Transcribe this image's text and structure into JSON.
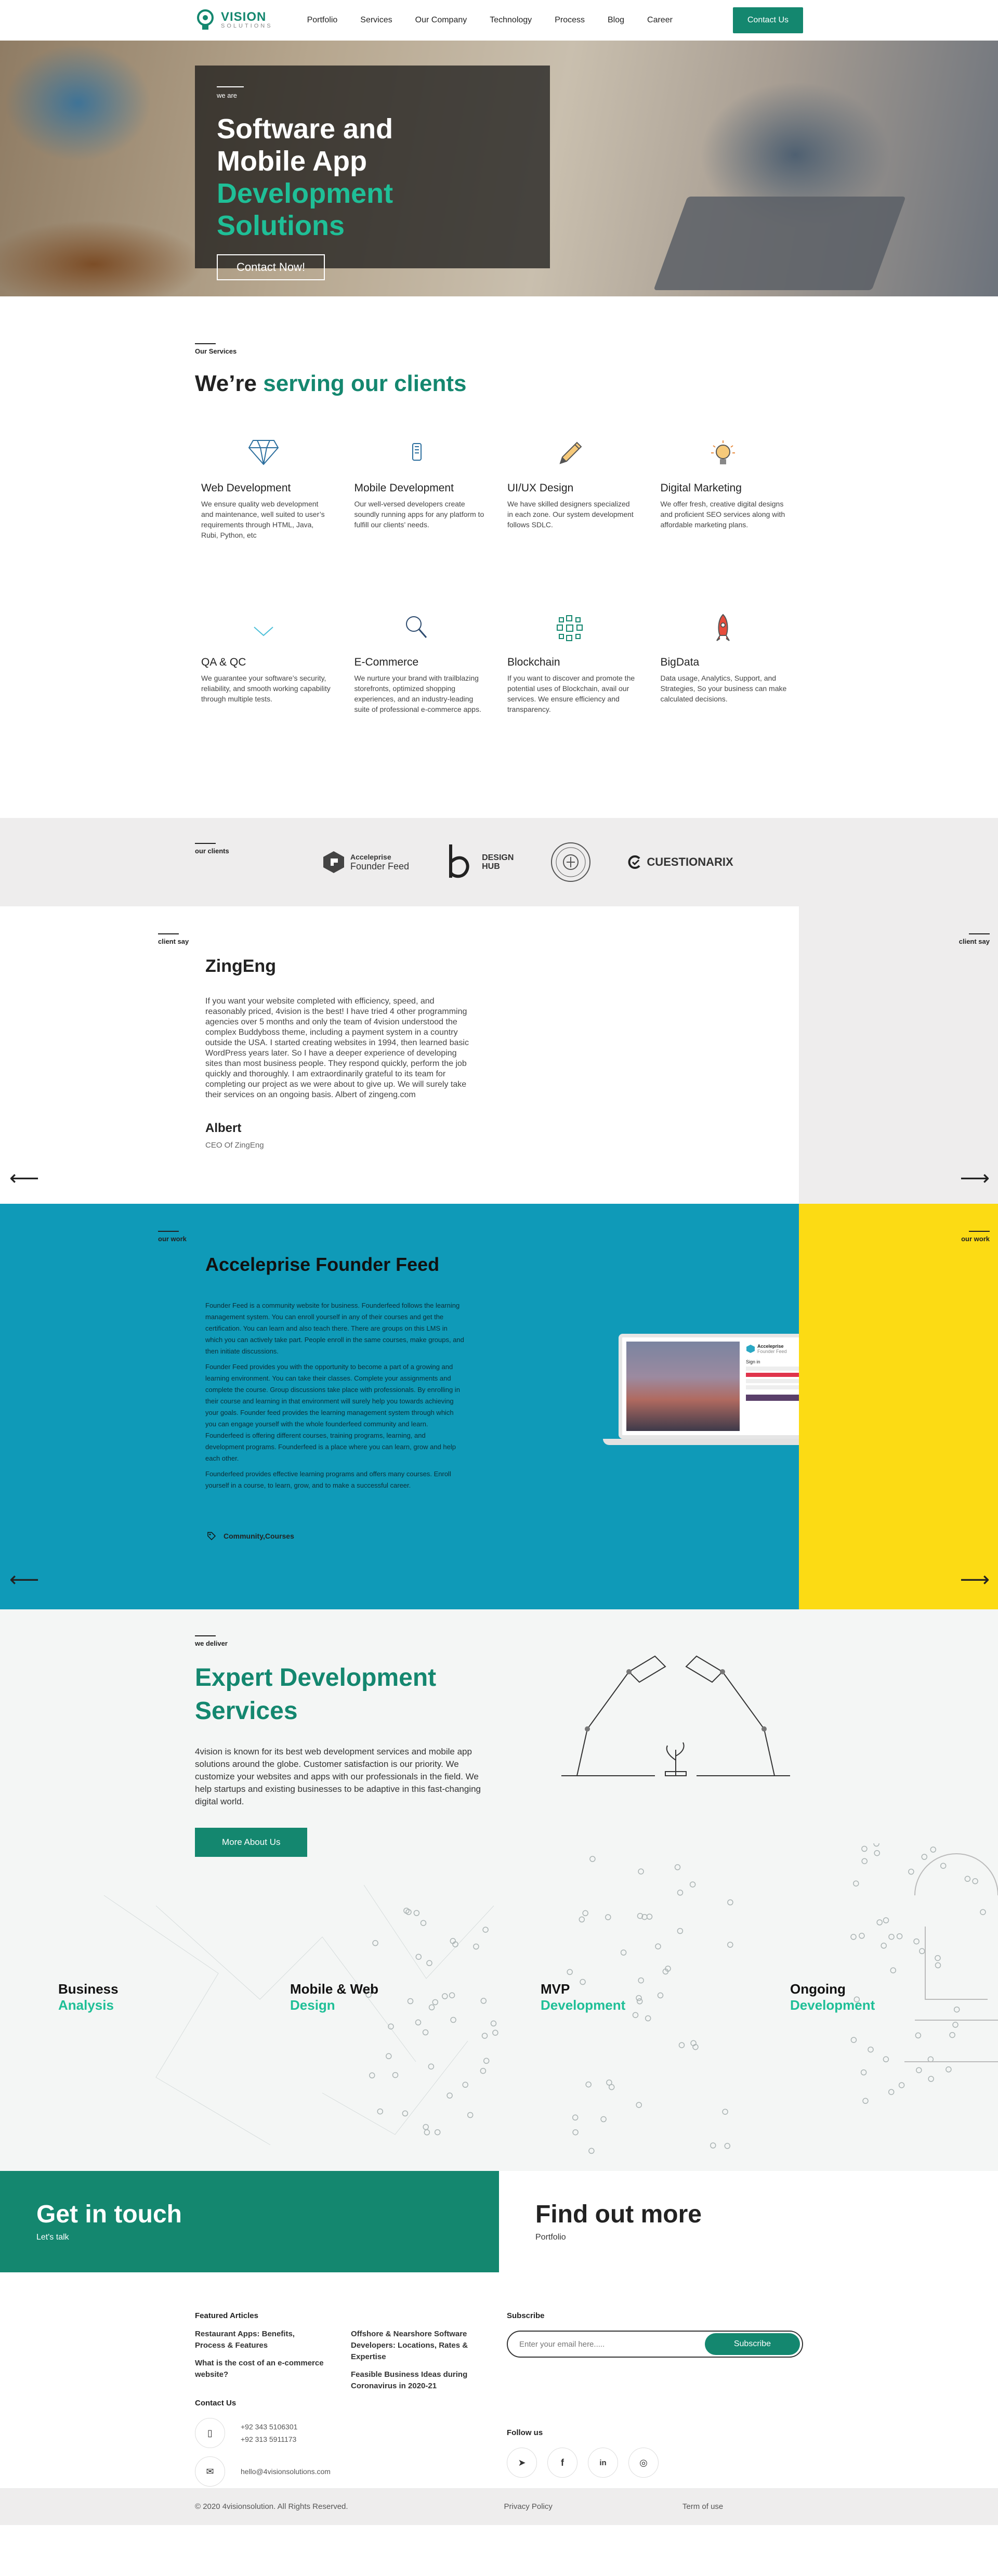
{
  "brand": {
    "name": "VISION",
    "tagline": "SOLUTIONS",
    "accent": "#14876f",
    "accent_light": "#1fbf97"
  },
  "nav": {
    "items": [
      "Portfolio",
      "Services",
      "Our Company",
      "Technology",
      "Process",
      "Blog",
      "Career"
    ],
    "cta": "Contact Us"
  },
  "hero": {
    "kicker": "we are",
    "line1": "Software and",
    "line2": "Mobile App",
    "line3": "Development Solutions",
    "button": "Contact Now!"
  },
  "services": {
    "kicker": "Our Services",
    "title_plain": "We’re ",
    "title_highlight": "serving our clients",
    "items": [
      {
        "icon": "diamond-icon",
        "name": "Web Development",
        "desc": "We ensure quality web development and maintenance, well suited to user’s requirements through HTML, Java, Rubi, Python, etc"
      },
      {
        "icon": "mobile-phone-icon",
        "name": "Mobile Development",
        "desc": "Our well-versed developers create soundly running apps for any platform to fulfill our clients’ needs."
      },
      {
        "icon": "pencil-icon",
        "name": "UI/UX Design",
        "desc": "We have skilled designers specialized in each zone. Our system development follows SDLC."
      },
      {
        "icon": "lightbulb-icon",
        "name": "Digital Marketing",
        "desc": "We offer fresh, creative digital designs and proficient SEO services along with affordable marketing plans."
      },
      {
        "icon": "chevron-check-icon",
        "name": "QA & QC",
        "desc": "We guarantee your software’s security, reliability, and smooth working capability through multiple tests."
      },
      {
        "icon": "magnifier-icon",
        "name": "E-Commerce",
        "desc": "We nurture your brand with trailblazing storefronts, optimized shopping experiences, and an industry-leading suite of professional e-commerce apps."
      },
      {
        "icon": "network-icon",
        "name": "Blockchain",
        "desc": "If you want to discover and promote the potential uses of Blockchain, avail our services. We ensure efficiency and transparency."
      },
      {
        "icon": "rocket-icon",
        "name": "BigData",
        "desc": "Data usage, Analytics, Support, and Strategies, So your business can make calculated decisions."
      }
    ]
  },
  "clients": {
    "kicker": "our clients",
    "logos": [
      "Acceleprise",
      "Founder Feed",
      "DESIGN",
      "HUB",
      "CUESTIONARIX"
    ]
  },
  "testimonial": {
    "kicker": "client say",
    "name": "ZingEng",
    "text": "If you want your website completed with efficiency, speed, and reasonably priced, 4vision is the best! I have tried 4 other programming agencies over 5 months and only the team of 4vision understood the complex Buddyboss theme, including a payment system in a country outside the USA. I started creating websites in 1994, then learned basic WordPress years later. So I have a deeper experience of developing sites than most business people. They respond quickly, perform the job quickly and thoroughly. I am extraordinarily grateful to its team for completing our project as we were about to give up. We will surely take their services on an ongoing basis. Albert of zingeng.com",
    "author": "Albert",
    "role": "CEO Of ZingEng"
  },
  "work": {
    "kicker": "our work",
    "title": "Acceleprise Founder Feed",
    "paragraphs": [
      "Founder Feed is a community website for business. Founderfeed follows the learning management system. You can enroll yourself in any of their courses and get the certification. You can learn and also teach there. There are groups on this LMS in which you can actively take part. People enroll in the same courses, make groups, and then initiate discussions.",
      "Founder Feed provides you with the opportunity to become a part of a growing and learning environment. You can take their classes. Complete your assignments and complete the course. Group discussions take place with professionals. By enrolling in their course and learning in that environment will surely help you towards achieving your goals. Founder feed provides the learning management system through which you can engage yourself with the whole founderfeed community and learn. Founderfeed is offering different courses, training programs, learning, and development programs. Founderfeed is a place where you can learn, grow and help each other.",
      "Founderfeed provides effective learning programs and offers many courses. Enroll yourself in a course, to learn, grow, and to make a successful career."
    ],
    "tag": "Community,Courses",
    "device": {
      "brand": "Acceleprise",
      "sub": "Founder Feed",
      "form_title": "Sign in"
    }
  },
  "deliver": {
    "kicker": "we deliver",
    "title_line1": "Expert Development",
    "title_line2": "Services",
    "text": "4vision is known for its best web development services and mobile app solutions around the globe. Customer satisfaction is our priority. We customize your websites and apps with our professionals in the field. We help startups and existing businesses to be adaptive in this fast-changing digital world.",
    "button": "More About Us",
    "phases": [
      {
        "top": "Business",
        "bottom": "Analysis"
      },
      {
        "top": "Mobile & Web",
        "bottom": "Design"
      },
      {
        "top": "MVP",
        "bottom": "Development"
      },
      {
        "top": "Ongoing",
        "bottom": "Development"
      }
    ]
  },
  "touch": {
    "left_title": "Get in touch",
    "left_sub": "Let's talk",
    "right_title": "Find out more",
    "right_sub": "Portfolio"
  },
  "footer": {
    "articles_heading": "Featured Articles",
    "articles": [
      "Restaurant Apps: Benefits, Process & Features",
      "What is the cost of an e-commerce website?",
      "Offshore & Nearshore Software Developers: Locations, Rates & Expertise",
      "Feasible Business Ideas during Coronavirus in 2020-21"
    ],
    "subscribe_heading": "Subscribe",
    "subscribe_placeholder": "Enter your email here.....",
    "subscribe_button": "Subscribe",
    "contact_heading": "Contact Us",
    "phone1": "+92 343 5106301",
    "phone2": "+92 313 5911173",
    "email": "hello@4visionsolutions.com",
    "follow_heading": "Follow us",
    "social": [
      "telegram-icon",
      "facebook-icon",
      "linkedin-icon",
      "instagram-icon"
    ],
    "copyright": "© 2020 4visionsolution. All Rights Reserved.",
    "privacy": "Privacy Policy",
    "terms": "Term of use"
  }
}
